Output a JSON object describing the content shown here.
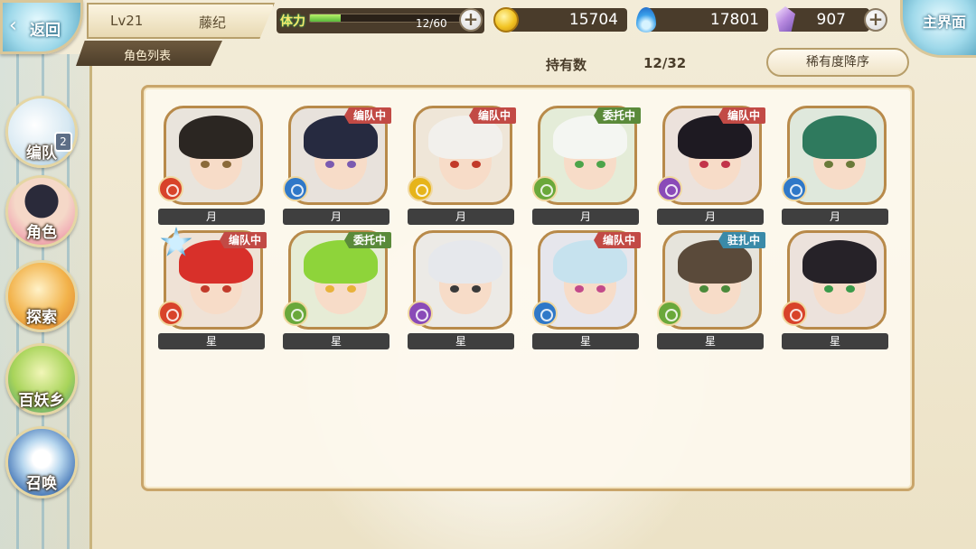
{
  "header": {
    "back_label": "返回",
    "level": "Lv21",
    "player_name": "藤纪",
    "list_tab": "角色列表",
    "main_label": "主界面"
  },
  "resources": {
    "stamina_label": "体力",
    "stamina_text": "12/60",
    "stamina_fraction": 0.2,
    "gold": "15704",
    "spirit": "17801",
    "gem": "907"
  },
  "summary": {
    "owned_label": "持有数",
    "owned_value": "12/32",
    "sort_label": "稀有度降序"
  },
  "nav": {
    "items": [
      {
        "label": "编队",
        "badge": "2"
      },
      {
        "label": "角色",
        "badge": ""
      },
      {
        "label": "探索",
        "badge": ""
      },
      {
        "label": "百妖乡",
        "badge": ""
      },
      {
        "label": "召唤",
        "badge": ""
      }
    ]
  },
  "characters": [
    {
      "rank": "月",
      "status": "",
      "status_color": "",
      "element": "fire",
      "hair": "#2b2622",
      "bg": "#e9e4dc",
      "eye": "#8a6a3a"
    },
    {
      "rank": "月",
      "status": "编队中",
      "status_color": "#c24a45",
      "element": "water",
      "hair": "#262a40",
      "bg": "#e8e2dc",
      "eye": "#7a5ab0"
    },
    {
      "rank": "月",
      "status": "编队中",
      "status_color": "#c24a45",
      "element": "light",
      "hair": "#f2f0ec",
      "bg": "#efe6d8",
      "eye": "#c23a2a"
    },
    {
      "rank": "月",
      "status": "委托中",
      "status_color": "#5a8a3a",
      "element": "wind",
      "hair": "#f4f6f2",
      "bg": "#e4ecd8",
      "eye": "#4ca44a"
    },
    {
      "rank": "月",
      "status": "编队中",
      "status_color": "#c24a45",
      "element": "dark",
      "hair": "#1e1a22",
      "bg": "#ece2dc",
      "eye": "#c2344a"
    },
    {
      "rank": "月",
      "status": "",
      "status_color": "",
      "element": "water",
      "hair": "#2f7a5e",
      "bg": "#dfe8dc",
      "eye": "#6a7a3a"
    },
    {
      "rank": "星",
      "status": "编队中",
      "status_color": "#c24a45",
      "element": "fire",
      "hair": "#d8302a",
      "bg": "#efe2d6",
      "eye": "#c23a2a",
      "rank_icon": true
    },
    {
      "rank": "星",
      "status": "委托中",
      "status_color": "#5a8a3a",
      "element": "wind",
      "hair": "#8ed43a",
      "bg": "#e6ecd6",
      "eye": "#e8b23a"
    },
    {
      "rank": "星",
      "status": "",
      "status_color": "",
      "element": "dark",
      "hair": "#e6e8ec",
      "bg": "#eceae6",
      "eye": "#3a3a3a"
    },
    {
      "rank": "星",
      "status": "编队中",
      "status_color": "#c24a45",
      "element": "water",
      "hair": "#c6e2ee",
      "bg": "#e6e6ec",
      "eye": "#c24a8a"
    },
    {
      "rank": "星",
      "status": "驻扎中",
      "status_color": "#3a8aa8",
      "element": "wind",
      "hair": "#5a4a3a",
      "bg": "#e6e4dc",
      "eye": "#4a8a3a"
    },
    {
      "rank": "星",
      "status": "",
      "status_color": "",
      "element": "fire",
      "hair": "#262228",
      "bg": "#ece2dc",
      "eye": "#3a9a4a"
    }
  ],
  "colors": {
    "fire": "#d8432a",
    "water": "#2f78c8",
    "light": "#e6b41a",
    "wind": "#6aa83a",
    "dark": "#8a4ab8"
  }
}
